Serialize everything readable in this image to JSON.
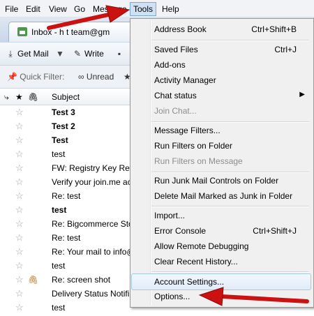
{
  "menubar": {
    "file": "File",
    "edit": "Edit",
    "view": "View",
    "go": "Go",
    "message": "Message",
    "tools": "Tools",
    "help": "Help"
  },
  "tab": {
    "label": "Inbox - h      t   team@gm"
  },
  "toolbar": {
    "get_mail": "Get Mail",
    "write": "Write"
  },
  "quick_filter": {
    "label": "Quick Filter:",
    "unread": "Unread"
  },
  "list_header": {
    "subject": "Subject"
  },
  "messages": [
    {
      "subject": "Test 3",
      "bold": true
    },
    {
      "subject": "Test 2",
      "bold": true
    },
    {
      "subject": "Test",
      "bold": true
    },
    {
      "subject": "test",
      "bold": false
    },
    {
      "subject": "FW: Registry Key Req",
      "bold": false
    },
    {
      "subject": "Verify your join.me ac",
      "bold": false
    },
    {
      "subject": "Re: test",
      "bold": false
    },
    {
      "subject": "test",
      "bold": true
    },
    {
      "subject": "Re: Bigcommerce Sto",
      "bold": false
    },
    {
      "subject": "Re: test",
      "bold": false
    },
    {
      "subject": "Re: Your mail to info@",
      "bold": false
    },
    {
      "subject": "test",
      "bold": false
    },
    {
      "subject": "Re: screen shot",
      "bold": false
    },
    {
      "subject": "Delivery Status Notifi",
      "bold": false
    },
    {
      "subject": "test",
      "bold": false
    }
  ],
  "tools_menu": {
    "address_book": "Address Book",
    "address_book_sc": "Ctrl+Shift+B",
    "saved_files": "Saved Files",
    "saved_files_sc": "Ctrl+J",
    "addons": "Add-ons",
    "activity_manager": "Activity Manager",
    "chat_status": "Chat status",
    "join_chat": "Join Chat...",
    "message_filters": "Message Filters...",
    "run_filters_folder": "Run Filters on Folder",
    "run_filters_message": "Run Filters on Message",
    "run_junk": "Run Junk Mail Controls on Folder",
    "delete_junk": "Delete Mail Marked as Junk in Folder",
    "import": "Import...",
    "error_console": "Error Console",
    "error_console_sc": "Ctrl+Shift+J",
    "remote_debugging": "Allow Remote Debugging",
    "clear_history": "Clear Recent History...",
    "account_settings": "Account Settings...",
    "options": "Options..."
  },
  "colors": {
    "arrow": "#cc1111",
    "menu_highlight": "#e1ecf9"
  }
}
